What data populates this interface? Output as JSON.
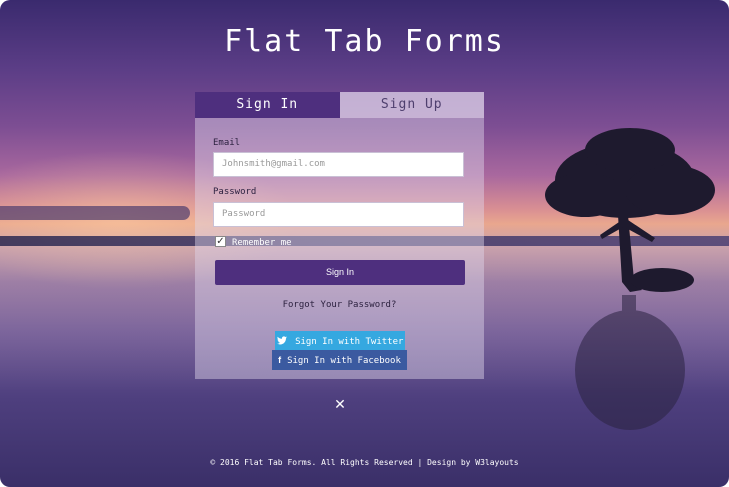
{
  "page": {
    "title": "Flat Tab Forms"
  },
  "tabs": [
    {
      "label": "Sign In",
      "active": true
    },
    {
      "label": "Sign Up",
      "active": false
    }
  ],
  "form": {
    "email_label": "Email",
    "email_placeholder": "Johnsmith@gmail.com",
    "password_label": "Password",
    "password_placeholder": "Password",
    "remember_label": "Remember me",
    "remember_checked": true,
    "submit_label": "Sign In",
    "forgot_label": "Forgot Your Password?"
  },
  "social": {
    "twitter_label": "Sign In with Twitter",
    "facebook_label": "Sign In with Facebook"
  },
  "close_glyph": "✕",
  "footer": "© 2016 Flat Tab Forms. All Rights Reserved | Design by W3layouts",
  "colors": {
    "primary": "#4e2f7e",
    "twitter": "#35a8e0",
    "facebook": "#3b5aa0"
  },
  "icons": [
    "twitter-icon",
    "facebook-icon",
    "check-icon",
    "close-icon"
  ]
}
